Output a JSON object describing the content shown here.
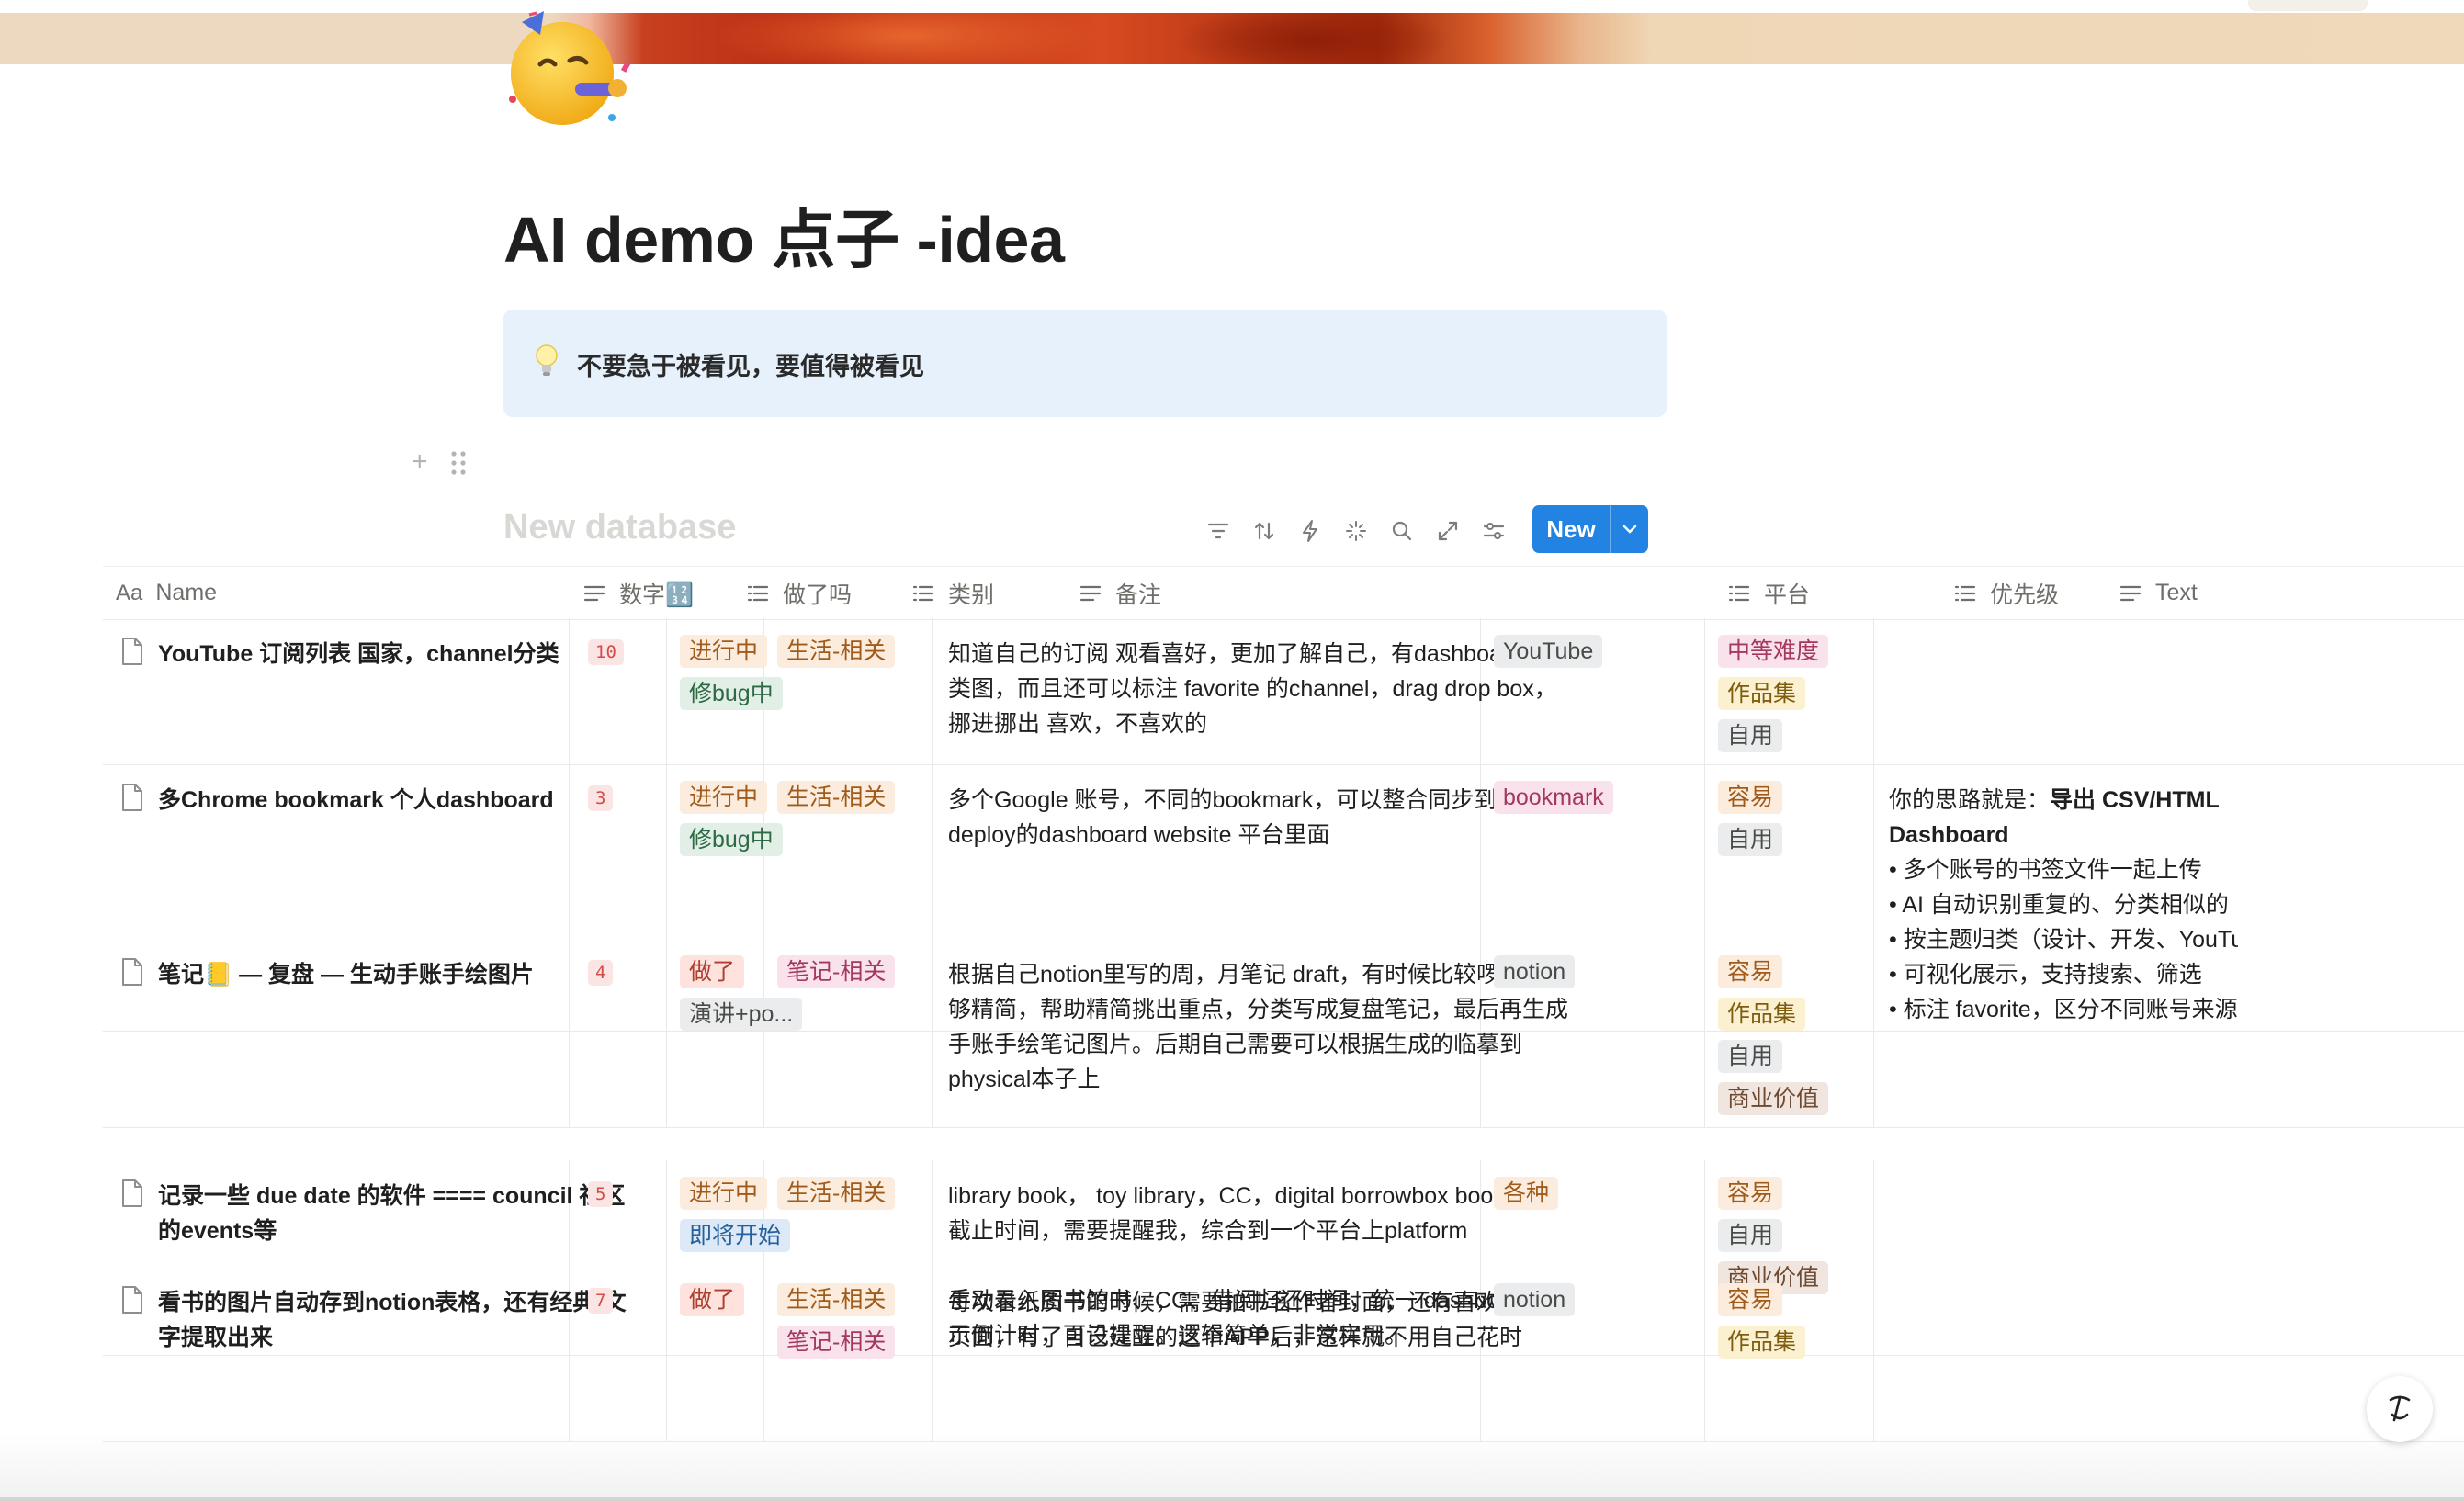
{
  "page": {
    "title": "AI demo 点子 -idea",
    "callout": "不要急于被看见，要值得被看见"
  },
  "database": {
    "title": "New database",
    "new_label": "New",
    "toolbar_icons": [
      "filter-icon",
      "sort-icon",
      "automation-icon",
      "ai-icon",
      "search-icon",
      "expand-icon",
      "settings-icon"
    ]
  },
  "columns": [
    "Name",
    "数字🔢",
    "做了吗",
    "类别",
    "备注",
    "平台",
    "优先级",
    "Text"
  ],
  "rows": [
    {
      "name": "YouTube 订阅列表 国家，channel分类",
      "num": "10",
      "status": [
        {
          "label": "进行中",
          "color": "orange"
        },
        {
          "label": "修bug中",
          "color": "green"
        }
      ],
      "category": [
        {
          "label": "生活-相关",
          "color": "orange"
        }
      ],
      "notes": [
        "知道自己的订阅 观看喜好，更加了解自己，有dashboard，分类图，而且还可以标注 favorite 的channel，drag drop box，挪进挪出 喜欢，不喜欢的"
      ],
      "platform": [
        {
          "label": "YouTube",
          "color": "gray"
        }
      ],
      "priority": [
        {
          "label": "中等难度",
          "color": "pink"
        },
        {
          "label": "作品集",
          "color": "yellow"
        },
        {
          "label": "自用",
          "color": "gray"
        }
      ],
      "text": []
    },
    {
      "name": "多Chrome bookmark 个人dashboard",
      "num": "3",
      "status": [
        {
          "label": "进行中",
          "color": "orange"
        },
        {
          "label": "修bug中",
          "color": "green"
        }
      ],
      "category": [
        {
          "label": "生活-相关",
          "color": "orange"
        }
      ],
      "notes": [
        "多个Google 账号，不同的bookmark，可以整合同步到自己deploy的dashboard website 平台里面"
      ],
      "platform": [
        {
          "label": "bookmark",
          "color": "pink"
        }
      ],
      "priority": [
        {
          "label": "容易",
          "color": "orange"
        },
        {
          "label": "自用",
          "color": "gray"
        }
      ],
      "text": [
        {
          "prefix": "你的思路就是：",
          "bold": "导出 CSV/HTML"
        },
        {
          "prefix": "",
          "bold": "Dashboard"
        },
        {
          "prefix": "• 多个账号的书签文件一起上传",
          "bold": ""
        },
        {
          "prefix": "• AI 自动识别重复的、分类相似的",
          "bold": ""
        },
        {
          "prefix": "• 按主题归类（设计、开发、YouTube",
          "bold": ""
        },
        {
          "prefix": "• 可视化展示，支持搜索、筛选",
          "bold": ""
        },
        {
          "prefix": "• 标注 favorite，区分不同账号来源",
          "bold": ""
        }
      ]
    },
    {
      "name": "笔记📒 — 复盘 — 生动手账手绘图片",
      "num": "4",
      "status": [
        {
          "label": "做了",
          "color": "red"
        },
        {
          "label": "演讲+po...",
          "color": "gray"
        }
      ],
      "category": [
        {
          "label": "笔记-相关",
          "color": "pink"
        }
      ],
      "notes": [
        "根据自己notion里写的周，月笔记 draft，有时候比较啰嗦，不够精简，帮助精简挑出重点，分类写成复盘笔记，最后再生成手账手绘笔记图片。后期自己需要可以根据生成的临摹到physical本子上"
      ],
      "platform": [
        {
          "label": "notion",
          "color": "gray"
        }
      ],
      "priority": [
        {
          "label": "容易",
          "color": "orange"
        },
        {
          "label": "作品集",
          "color": "yellow"
        },
        {
          "label": "自用",
          "color": "gray"
        },
        {
          "label": "商业价值",
          "color": "brown"
        }
      ],
      "text": []
    },
    {
      "name": "记录一些 due date 的软件 ==== council 社区的events等",
      "num": "5",
      "status": [
        {
          "label": "进行中",
          "color": "orange"
        },
        {
          "label": "即将开始",
          "color": "blue"
        }
      ],
      "category": [
        {
          "label": "生活-相关",
          "color": "orange"
        }
      ],
      "notes": [
        "library book， toy library，CC，digital borrowbox book，等截止时间，需要提醒我，综合到一个平台上platform",
        "",
        "手动录入图书馆书、CC、借阅归还时间，统一 dashboard 展示倒计时，可设提醒。逻辑简单，非常实用。"
      ],
      "platform": [
        {
          "label": "各种",
          "color": "orange"
        }
      ],
      "priority": [
        {
          "label": "容易",
          "color": "orange"
        },
        {
          "label": "自用",
          "color": "gray"
        },
        {
          "label": "商业价值",
          "color": "brown"
        }
      ],
      "text": []
    },
    {
      "name": "看书的图片自动存到notion表格，还有经典-文字提取出来",
      "num": "7",
      "status": [
        {
          "label": "做了",
          "color": "red"
        }
      ],
      "category": [
        {
          "label": "生活-相关",
          "color": "orange"
        },
        {
          "label": "笔记-相关",
          "color": "pink"
        }
      ],
      "notes": [
        "每次看纸质书的时候，需要拍书名作者封面，还有喜欢的文字页面，有了自己建立的这个APP后，这样就不用自己花时"
      ],
      "platform": [
        {
          "label": "notion",
          "color": "gray"
        }
      ],
      "priority": [
        {
          "label": "容易",
          "color": "orange"
        },
        {
          "label": "作品集",
          "color": "yellow"
        }
      ],
      "text": []
    }
  ]
}
